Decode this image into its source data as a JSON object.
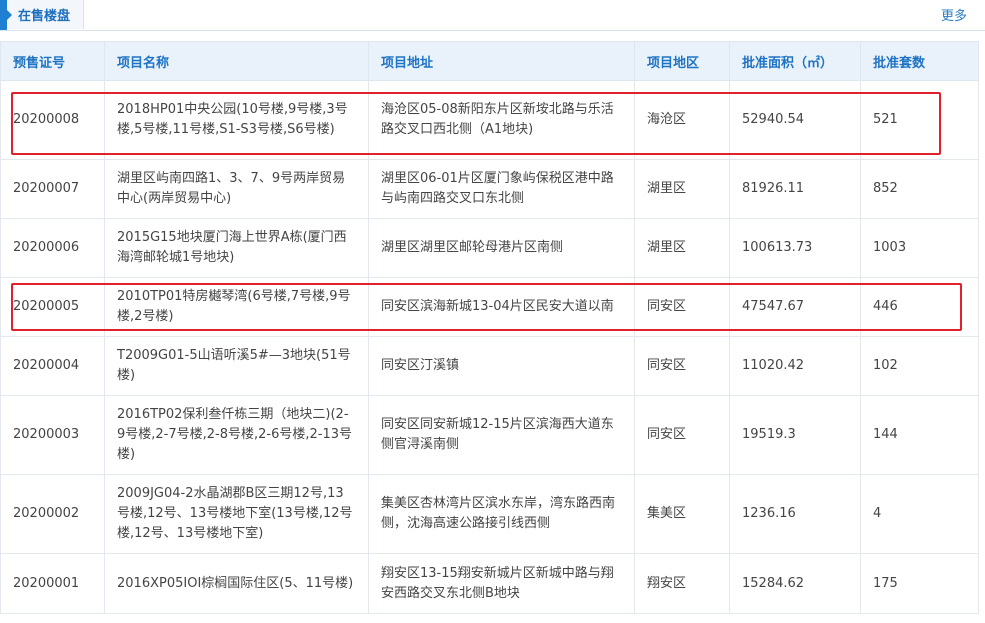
{
  "tab": {
    "label": "在售楼盘",
    "more": "更多"
  },
  "table": {
    "headers": [
      "预售证号",
      "项目名称",
      "项目地址",
      "项目地区",
      "批准面积（㎡）",
      "批准套数"
    ],
    "rows": [
      {
        "id": "20200008",
        "name": "2018HP01中央公园(10号楼,9号楼,3号楼,5号楼,11号楼,S1-S3号楼,S6号楼)",
        "address": "海沧区05-08新阳东片区新垵北路与乐活路交叉口西北侧（A1地块)",
        "district": "海沧区",
        "area": "52940.54",
        "units": "521"
      },
      {
        "id": "20200007",
        "name": "湖里区屿南四路1、3、7、9号两岸贸易中心(两岸贸易中心)",
        "address": "湖里区06-01片区厦门象屿保税区港中路与屿南四路交叉口东北侧",
        "district": "湖里区",
        "area": "81926.11",
        "units": "852"
      },
      {
        "id": "20200006",
        "name": "2015G15地块厦门海上世界A栋(厦门西海湾邮轮城1号地块)",
        "address": "湖里区湖里区邮轮母港片区南侧",
        "district": "湖里区",
        "area": "100613.73",
        "units": "1003"
      },
      {
        "id": "20200005",
        "name": "2010TP01特房樾琴湾(6号楼,7号楼,9号楼,2号楼)",
        "address": "同安区滨海新城13-04片区民安大道以南",
        "district": "同安区",
        "area": "47547.67",
        "units": "446"
      },
      {
        "id": "20200004",
        "name": "T2009G01-5山语听溪5#—3地块(51号楼)",
        "address": "同安区汀溪镇",
        "district": "同安区",
        "area": "11020.42",
        "units": "102"
      },
      {
        "id": "20200003",
        "name": "2016TP02保利叁仟栋三期（地块二)(2-9号楼,2-7号楼,2-8号楼,2-6号楼,2-13号楼)",
        "address": "同安区同安新城12-15片区滨海西大道东侧官浔溪南侧",
        "district": "同安区",
        "area": "19519.3",
        "units": "144"
      },
      {
        "id": "20200002",
        "name": "2009JG04-2水晶湖郡B区三期12号,13号楼,12号、13号楼地下室(13号楼,12号楼,12号、13号楼地下室)",
        "address": "集美区杏林湾片区滨水东岸，湾东路西南侧，沈海高速公路接引线西侧",
        "district": "集美区",
        "area": "1236.16",
        "units": "4"
      },
      {
        "id": "20200001",
        "name": "2016XP05IOI棕榈国际住区(5、11号楼)",
        "address": "翔安区13-15翔安新城片区新城中路与翔安西路交叉东北侧B地块",
        "district": "翔安区",
        "area": "15284.62",
        "units": "175"
      }
    ]
  },
  "colors": {
    "accent": "#1f7fd0",
    "header_bg": "#e9f2fb",
    "highlight": "#e0202a"
  }
}
